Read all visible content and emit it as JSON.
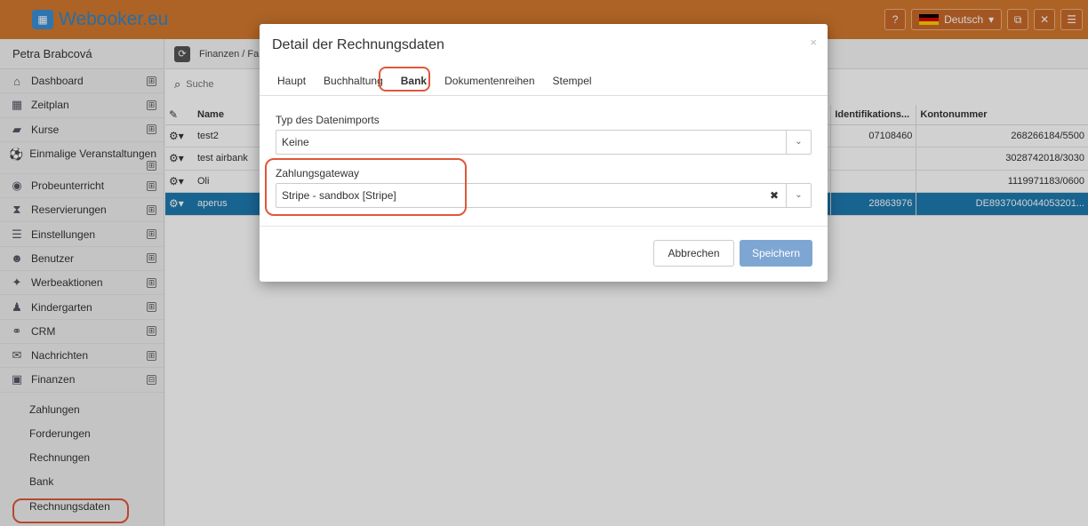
{
  "app": {
    "logo_text": "Webooker.eu"
  },
  "topbar": {
    "language": "Deutsch"
  },
  "colors": {
    "accent": "#d4792e",
    "selected_row": "#1e7bb0",
    "save_button": "#7ea6d3",
    "highlight": "#e0573a"
  },
  "sidebar": {
    "user_name": "Petra Brabcová",
    "items": [
      {
        "label": "Dashboard",
        "icon": "home-icon",
        "toggle": "⊞"
      },
      {
        "label": "Zeitplan",
        "icon": "calendar-icon",
        "toggle": "⊞"
      },
      {
        "label": "Kurse",
        "icon": "book-icon",
        "toggle": "⊞"
      },
      {
        "label": "Einmalige Veranstaltungen",
        "icon": "ball-icon",
        "toggle": "⊞"
      },
      {
        "label": "Probeunterricht",
        "icon": "eye-icon",
        "toggle": "⊞"
      },
      {
        "label": "Reservierungen",
        "icon": "hourglass-icon",
        "toggle": "⊞"
      },
      {
        "label": "Einstellungen",
        "icon": "settings-icon",
        "toggle": "⊞"
      },
      {
        "label": "Benutzer",
        "icon": "users-icon",
        "toggle": "⊞"
      },
      {
        "label": "Werbeaktionen",
        "icon": "gift-icon",
        "toggle": "⊞"
      },
      {
        "label": "Kindergarten",
        "icon": "child-icon",
        "toggle": "⊞"
      },
      {
        "label": "CRM",
        "icon": "handshake-icon",
        "toggle": "⊞"
      },
      {
        "label": "Nachrichten",
        "icon": "envelope-icon",
        "toggle": "⊞"
      },
      {
        "label": "Finanzen",
        "icon": "money-icon",
        "toggle": "⊟"
      }
    ],
    "sub_items": [
      "Zahlungen",
      "Forderungen",
      "Rechnungen",
      "Bank",
      "Rechnungsdaten"
    ]
  },
  "content": {
    "breadcrumb": "Finanzen / Fa",
    "search_placeholder": "Suche",
    "table": {
      "headers": {
        "name": "Name",
        "ident": "Identifikations...",
        "konto": "Kontonummer"
      },
      "rows": [
        {
          "name": "test2",
          "ident": "07108460",
          "konto": "268266184/5500"
        },
        {
          "name": "test airbank",
          "ident": "",
          "konto": "3028742018/3030"
        },
        {
          "name": "Oli",
          "ident": "",
          "konto": "1119971183/0600"
        },
        {
          "name": "aperus",
          "ident": "28863976",
          "konto": "DE8937040044053201..."
        }
      ]
    }
  },
  "modal": {
    "title": "Detail der Rechnungsdaten",
    "close": "×",
    "tabs": [
      "Haupt",
      "Buchhaltung",
      "Bank",
      "Dokumentenreihen",
      "Stempel"
    ],
    "import_type_label": "Typ des Datenimports",
    "import_type_value": "Keine",
    "gateway_label": "Zahlungsgateway",
    "gateway_value": "Stripe - sandbox [Stripe]",
    "cancel_label": "Abbrechen",
    "save_label": "Speichern"
  }
}
